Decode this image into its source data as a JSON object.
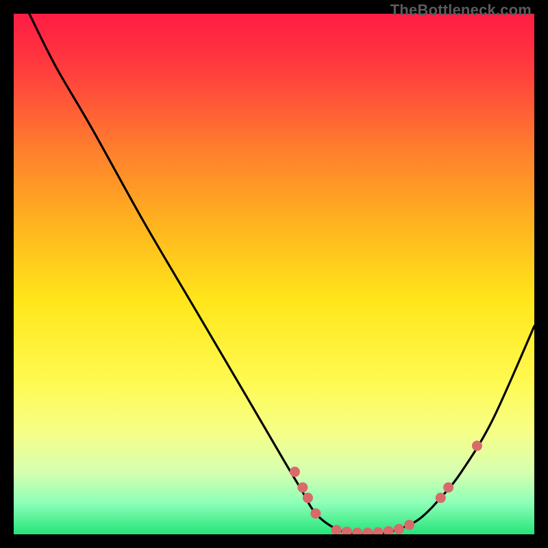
{
  "watermark": "TheBottleneck.com",
  "gradient": {
    "stops": [
      {
        "offset": 0.0,
        "color": "#ff1c44"
      },
      {
        "offset": 0.1,
        "color": "#ff3a3e"
      },
      {
        "offset": 0.25,
        "color": "#ff7a2f"
      },
      {
        "offset": 0.4,
        "color": "#ffb21f"
      },
      {
        "offset": 0.55,
        "color": "#ffe61a"
      },
      {
        "offset": 0.7,
        "color": "#fff94e"
      },
      {
        "offset": 0.8,
        "color": "#f7ff85"
      },
      {
        "offset": 0.88,
        "color": "#d7ffb0"
      },
      {
        "offset": 0.94,
        "color": "#8dffb8"
      },
      {
        "offset": 1.0,
        "color": "#24e47a"
      }
    ]
  },
  "dot_color": "#d86a6a",
  "curve_color": "#000000",
  "chart_data": {
    "type": "line",
    "title": "",
    "xlabel": "",
    "ylabel": "",
    "xlim": [
      0,
      100
    ],
    "ylim": [
      0,
      100
    ],
    "series": [
      {
        "name": "bottleneck-curve",
        "x": [
          3,
          8,
          15,
          25,
          35,
          45,
          52,
          55,
          58,
          62,
          66,
          70,
          74,
          78,
          82,
          86,
          92,
          100
        ],
        "y": [
          100,
          90,
          78,
          60,
          43,
          26,
          14,
          9,
          4,
          1,
          0,
          0,
          1,
          3,
          7,
          12,
          22,
          40
        ]
      }
    ],
    "markers": {
      "name": "highlight-dots",
      "points": [
        {
          "x": 54,
          "y": 12
        },
        {
          "x": 55.5,
          "y": 9
        },
        {
          "x": 56.5,
          "y": 7
        },
        {
          "x": 58,
          "y": 4
        },
        {
          "x": 62,
          "y": 0.8
        },
        {
          "x": 64,
          "y": 0.5
        },
        {
          "x": 66,
          "y": 0.3
        },
        {
          "x": 68,
          "y": 0.3
        },
        {
          "x": 70,
          "y": 0.4
        },
        {
          "x": 72,
          "y": 0.6
        },
        {
          "x": 74,
          "y": 1.0
        },
        {
          "x": 76,
          "y": 1.8
        },
        {
          "x": 82,
          "y": 7
        },
        {
          "x": 83.5,
          "y": 9
        },
        {
          "x": 89,
          "y": 17
        }
      ]
    }
  }
}
